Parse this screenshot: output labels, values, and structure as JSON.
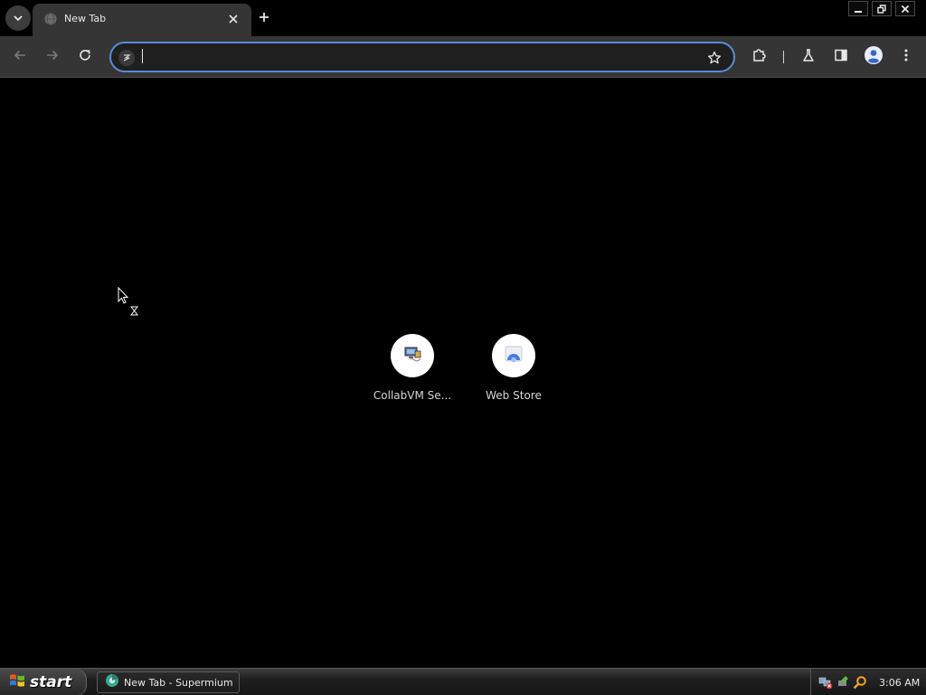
{
  "browser": {
    "tabs": [
      {
        "title": "New Tab",
        "active": true
      }
    ],
    "omnibox": {
      "value": "",
      "placeholder": ""
    },
    "accent_color": "#5a8bd8"
  },
  "new_tab_page": {
    "shortcuts": [
      {
        "label": "CollabVM Se...",
        "icon": "collabvm-icon"
      },
      {
        "label": "Web Store",
        "icon": "web-store-icon"
      }
    ]
  },
  "taskbar": {
    "start_label": "start",
    "tasks": [
      {
        "label": "New Tab - Supermium",
        "icon": "supermium-icon"
      }
    ],
    "clock": "3:06 AM",
    "tray_icons": [
      "network-error-icon",
      "safely-remove-icon",
      "search-icon"
    ]
  }
}
